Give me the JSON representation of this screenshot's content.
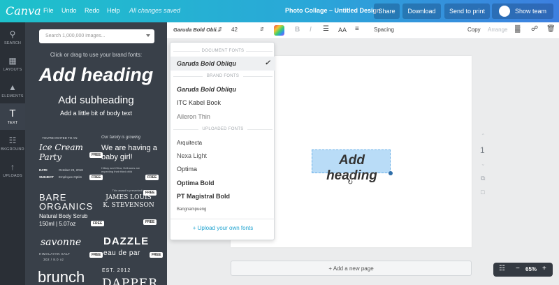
{
  "topbar": {
    "logo": "Canva",
    "menu": [
      "File",
      "Undo",
      "Redo",
      "Help"
    ],
    "saved_status": "All changes saved",
    "doc_title": "Photo Collage – Untitled Design",
    "share": "Share",
    "download": "Download",
    "send_to_print": "Send to print",
    "show_team": "Show team"
  },
  "rail": {
    "items": [
      {
        "label": "SEARCH",
        "icon": "search-icon"
      },
      {
        "label": "LAYOUTS",
        "icon": "layouts-icon"
      },
      {
        "label": "ELEMENTS",
        "icon": "elements-icon"
      },
      {
        "label": "TEXT",
        "icon": "text-icon"
      },
      {
        "label": "BKGROUND",
        "icon": "background-icon"
      },
      {
        "label": "UPLOADS",
        "icon": "uploads-icon"
      }
    ],
    "active": "TEXT"
  },
  "panel": {
    "search_placeholder": "Search 1,000,000 images...",
    "hint": "Click or drag to use your brand fonts:",
    "add_heading": "Add heading",
    "add_subheading": "Add subheading",
    "add_body": "Add a little bit of body text",
    "free_badge": "FREE",
    "templates": {
      "t1_invited": "YOU'RE INVITED TO AN",
      "t1_title": "Ice Cream Party",
      "t1_date_label": "DATE",
      "t1_date": "October 23, 2018",
      "t1_subject_label": "SUBJECT",
      "t1_subject": "Employee Optim",
      "t2_small": "Our family is growing",
      "t2_title": "We are having a baby girl!",
      "t2_body": "Hillary and Oliva, Delhanes are expecting their third child",
      "t3_title1": "BARE",
      "t3_title2": "ORGANICS",
      "t3_line1": "Natural Body Scrub",
      "t3_line2": "150ml | 5.07oz",
      "t4_small": "This award is presented to",
      "t4_name1": "JAMES LOUIS",
      "t4_name2": "K. STEVENSON",
      "t5_title": "savonne",
      "t5_sub": "HIMALAYAN SALT",
      "t5_sub2": "302 / 8.0 oz",
      "t6_title": "DAZZLE",
      "t6_sub": "eau de par",
      "t7_title": "brunch",
      "t8_small": "EST. 2012",
      "t8_title": "DAPPER"
    }
  },
  "format_bar": {
    "font": "Garuda Bold Obli...",
    "size": "42",
    "bold": "B",
    "italic": "I",
    "case": "AA",
    "spacing": "Spacing",
    "copy": "Copy",
    "arrange": "Arrange"
  },
  "font_dropdown": {
    "document_fonts_label": "DOCUMENT FONTS",
    "selected": "Garuda Bold Obliqu",
    "brand_fonts_label": "BRAND FONTS",
    "brand_fonts": [
      "Garuda Bold Obliqu",
      "ITC Kabel Book",
      "Aileron Thin"
    ],
    "uploaded_fonts_label": "UPLOADED FONTS",
    "uploaded_fonts": [
      "Arquitecta",
      "Nexa Light",
      "Optima",
      "Optima Bold",
      "PT Magistral Bold",
      "Bangnampueng"
    ],
    "upload_link": "+ Upload your own fonts"
  },
  "canvas": {
    "heading_text": "Add heading",
    "page_number": "1",
    "add_page": "+ Add a new page"
  },
  "zoom": {
    "level": "65%",
    "minus": "−",
    "plus": "+"
  },
  "colors": {
    "topbar_start": "#1ec1cb",
    "topbar_end": "#3d7fe0",
    "panel_bg": "#394049",
    "rail_bg": "#2a2f36",
    "selection": "#b9dcf7",
    "link": "#1fa3d0"
  }
}
